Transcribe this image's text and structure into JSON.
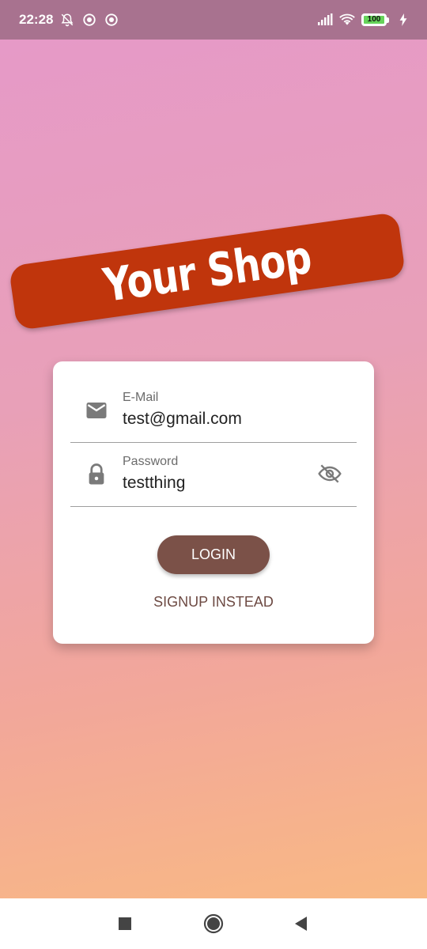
{
  "status_bar": {
    "time": "22:28",
    "battery_level": "100",
    "icons": [
      "mute-bell-icon",
      "app-icon",
      "app-icon",
      "signal-icon",
      "wifi-icon",
      "battery-icon",
      "charging-icon"
    ]
  },
  "banner": {
    "title": "Your Shop"
  },
  "form": {
    "email": {
      "label": "E-Mail",
      "value": "test@gmail.com",
      "icon": "mail-icon"
    },
    "password": {
      "label": "Password",
      "value": "testthing",
      "icon": "lock-icon",
      "toggle_icon": "eye-off-icon"
    },
    "login_label": "LOGIN",
    "signup_label": "SIGNUP INSTEAD"
  },
  "nav": {
    "icons": [
      "recents-icon",
      "home-icon",
      "back-icon"
    ]
  },
  "colors": {
    "banner": "#c0350c",
    "login_button": "#7b5148",
    "signup_text": "#6d4a43",
    "status_bar": "#a8728f",
    "gradient_top": "#e699c9",
    "gradient_bottom": "#fabc80"
  }
}
